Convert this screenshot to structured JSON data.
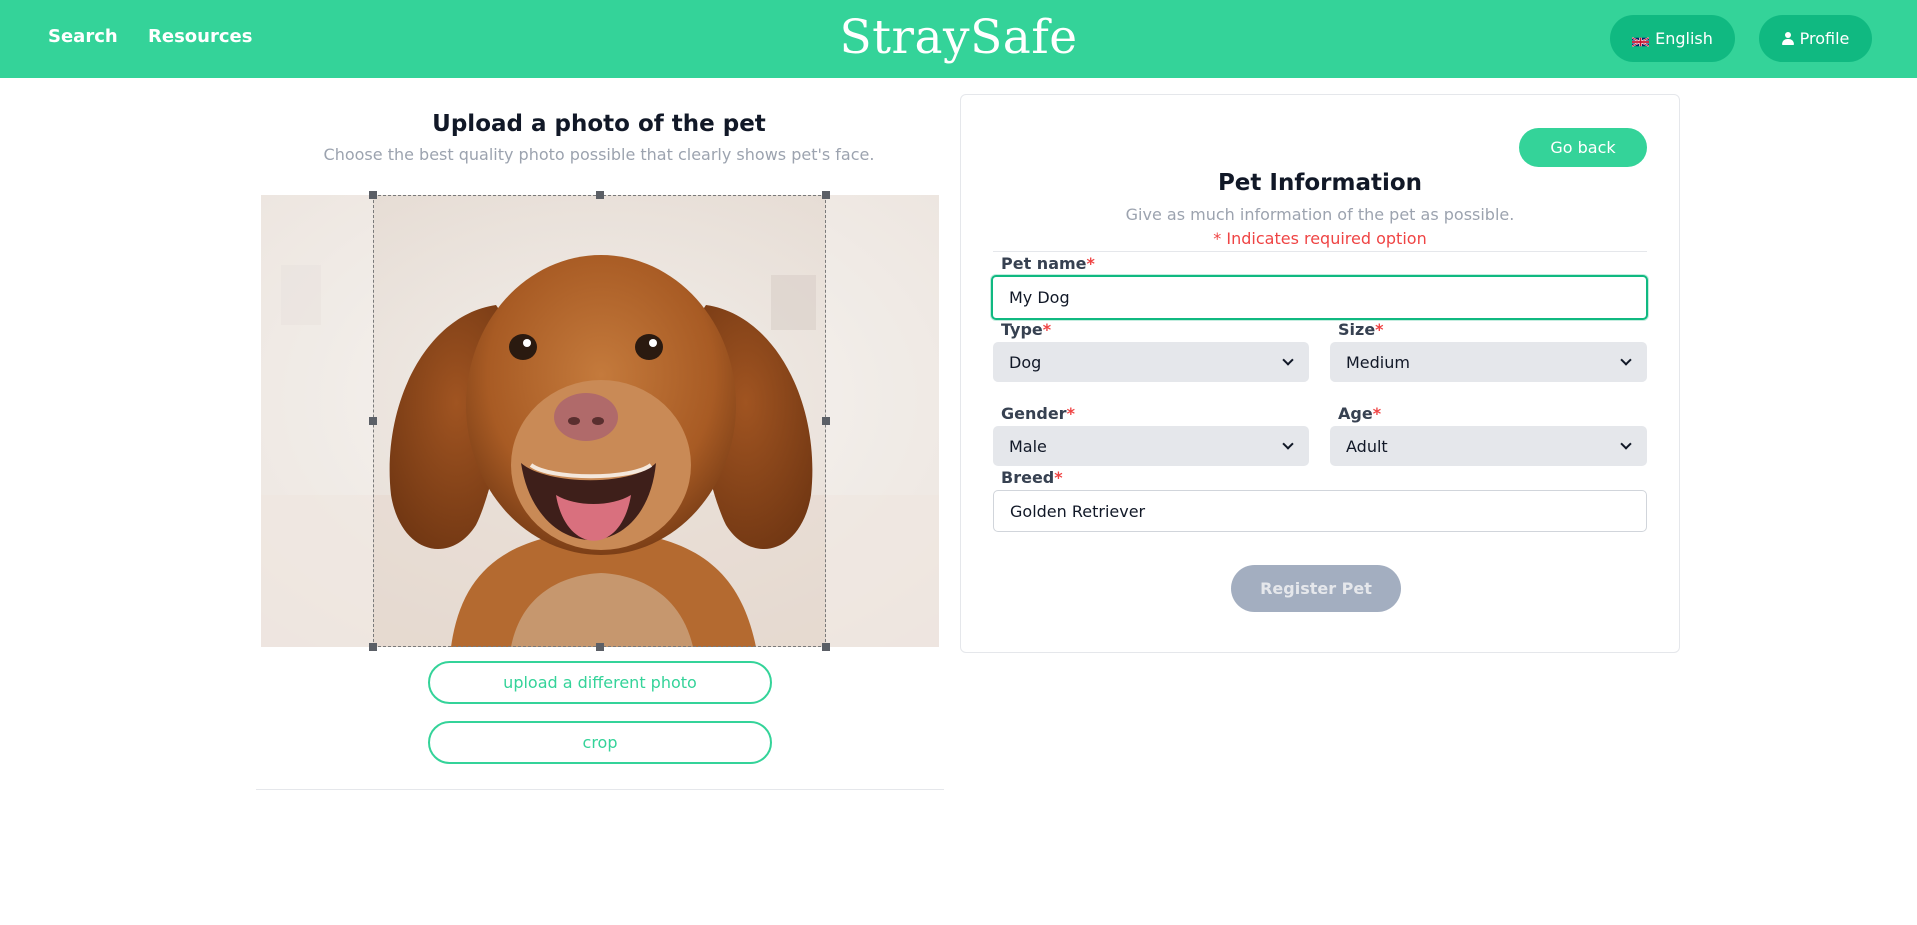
{
  "nav": {
    "search_label": "Search",
    "resources_label": "Resources",
    "brand": "StraySafe",
    "language_label": "English",
    "profile_label": "Profile",
    "language_icon": "uk-flag-icon",
    "profile_icon": "person-icon"
  },
  "upload": {
    "title": "Upload a photo of the pet",
    "subtitle": "Choose the best quality photo possible that clearly shows pet's face.",
    "upload_different_label": "upload a different photo",
    "crop_label": "crop"
  },
  "form": {
    "go_back_label": "Go back",
    "title": "Pet Information",
    "subtitle": "Give as much information of the pet as possible.",
    "required_note": "* Indicates required option",
    "required_star": "*",
    "pet_name": {
      "label": "Pet name",
      "value": "My Dog"
    },
    "type": {
      "label": "Type",
      "value": "Dog"
    },
    "size": {
      "label": "Size",
      "value": "Medium"
    },
    "gender": {
      "label": "Gender",
      "value": "Male"
    },
    "age": {
      "label": "Age",
      "value": "Adult"
    },
    "breed": {
      "label": "Breed",
      "value": "Golden Retriever"
    },
    "register_label": "Register Pet"
  },
  "colors": {
    "accent": "#34d399",
    "accent_dark": "#10b981",
    "required": "#ef4444",
    "disabled_button": "#a3aec0"
  }
}
